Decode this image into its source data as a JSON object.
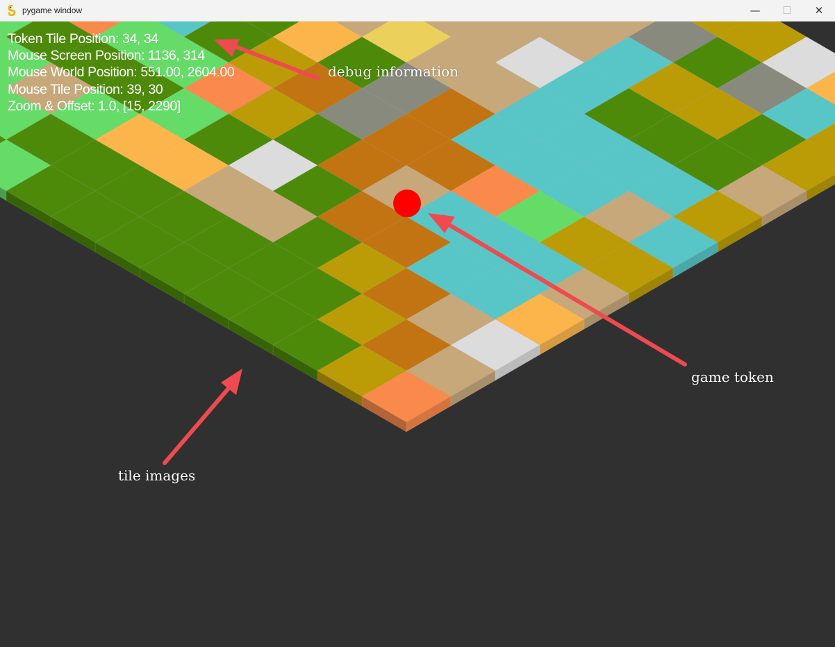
{
  "window": {
    "title": "pygame window",
    "controls": {
      "minimize": "—",
      "maximize": "☐",
      "close": "✕"
    }
  },
  "debug": {
    "token_tile_position": "Token Tile Position: 34, 34",
    "mouse_screen_position": "Mouse Screen Position: 1136, 314",
    "mouse_world_position": "Mouse World Position: 551.00, 2604.00",
    "mouse_tile_position": "Mouse Tile Position: 39, 30",
    "zoom_offset": "Zoom & Offset: 1.0, [15, 2290]"
  },
  "annotations": {
    "debug_label": "debug information",
    "token_label": "game token",
    "tiles_label": "tile images"
  },
  "colors": {
    "background": "#303030",
    "token": "#ff0000",
    "arrow": "#ef4a4f",
    "tile_palette": {
      "G": "#4d8a0a",
      "L": "#65dc68",
      "T": "#c7a87b",
      "O": "#f98a4b",
      "Y": "#fcb54b",
      "K": "#bb9c06",
      "B": "#c27412",
      "C": "#58c6c7",
      "W": "#dcdcdc",
      "S": "#878a7c",
      "P": "#ebd05c"
    }
  }
}
